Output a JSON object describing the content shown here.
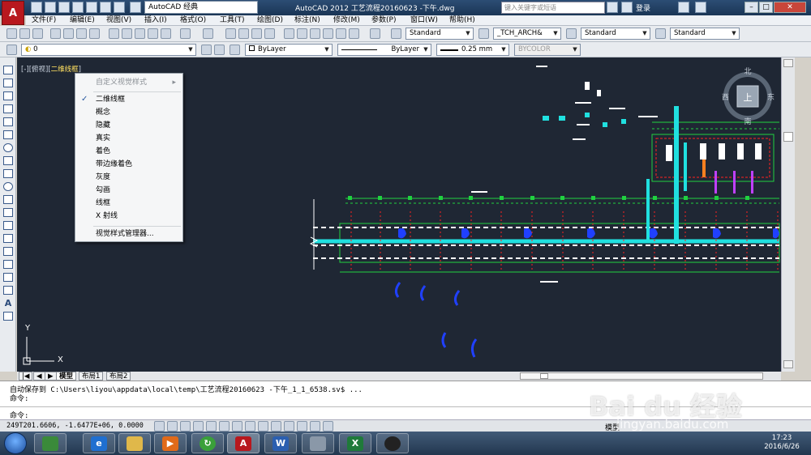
{
  "app": {
    "logo_letter": "A",
    "workspace": "AutoCAD 经典",
    "title": "AutoCAD 2012    工艺流程20160623 -下午.dwg",
    "search_placeholder": "键入关键字或短语",
    "login": "登录"
  },
  "menu": [
    "文件(F)",
    "编辑(E)",
    "视图(V)",
    "插入(I)",
    "格式(O)",
    "工具(T)",
    "绘图(D)",
    "标注(N)",
    "修改(M)",
    "参数(P)",
    "窗口(W)",
    "帮助(H)"
  ],
  "toolbar1": {
    "text_style": "Standard",
    "dim_style": "_TCH_ARCH&",
    "table_style": "Standard",
    "multileader_style": "Standard"
  },
  "toolbar2": {
    "layer": "0",
    "color": "ByLayer",
    "linetype": "ByLayer",
    "lineweight": "0.25 mm",
    "plot_style": "BYCOLOR"
  },
  "viewport": {
    "label_prefix": "[-][俯视][",
    "label_style": "二维线框",
    "label_suffix": "]"
  },
  "context_menu": {
    "header": "自定义视觉样式",
    "items": [
      {
        "label": "二维线框",
        "checked": true
      },
      {
        "label": "概念",
        "checked": false
      },
      {
        "label": "隐藏",
        "checked": false
      },
      {
        "label": "真实",
        "checked": false
      },
      {
        "label": "着色",
        "checked": false
      },
      {
        "label": "带边缘着色",
        "checked": false
      },
      {
        "label": "灰度",
        "checked": false
      },
      {
        "label": "勾画",
        "checked": false
      },
      {
        "label": "线框",
        "checked": false
      },
      {
        "label": "X 射线",
        "checked": false
      }
    ],
    "footer": "视觉样式管理器..."
  },
  "viewcube": {
    "north": "北",
    "south": "南",
    "east": "东",
    "west": "西",
    "face": "上"
  },
  "ucs": {
    "x": "X",
    "y": "Y"
  },
  "tabs": [
    "模型",
    "布局1",
    "布局2"
  ],
  "command": {
    "line1": "自动保存到 C:\\Users\\liyou\\appdata\\local\\temp\\工艺流程20160623 -下午_1_1_6538.sv$ ...",
    "line2": "命令:",
    "prompt": "命令:"
  },
  "status": {
    "coords": "249T201.6606, -1.6477E+06, 0.0000",
    "model_label": "模型"
  },
  "taskbar": {
    "apps": [
      {
        "icon": "pinwheel-icon",
        "color": "#3a8a3a"
      },
      {
        "icon": "ie-icon",
        "color": "#1f6fd0"
      },
      {
        "icon": "folder-icon",
        "color": "#e0b84a"
      },
      {
        "icon": "media-player-icon",
        "color": "#e06a1a"
      },
      {
        "icon": "refresh-icon",
        "color": "#3aa03a"
      },
      {
        "icon": "autocad-icon",
        "color": "#b8181e"
      },
      {
        "icon": "word-icon",
        "color": "#2b5fb0"
      },
      {
        "icon": "calculator-icon",
        "color": "#8a98a8"
      },
      {
        "icon": "excel-icon",
        "color": "#1f7a3a"
      },
      {
        "icon": "qq-icon",
        "color": "#222222"
      }
    ],
    "time": "17:23",
    "date": "2016/6/26"
  },
  "watermark": {
    "brand": "Bai du 经验",
    "url": "jingyan.baidu.com"
  },
  "colors": {
    "canvas_bg": "#1f2734",
    "drawing_red": "#ff2020",
    "drawing_green": "#20d040",
    "drawing_cyan": "#20e0e0",
    "drawing_blue": "#2040ff"
  }
}
